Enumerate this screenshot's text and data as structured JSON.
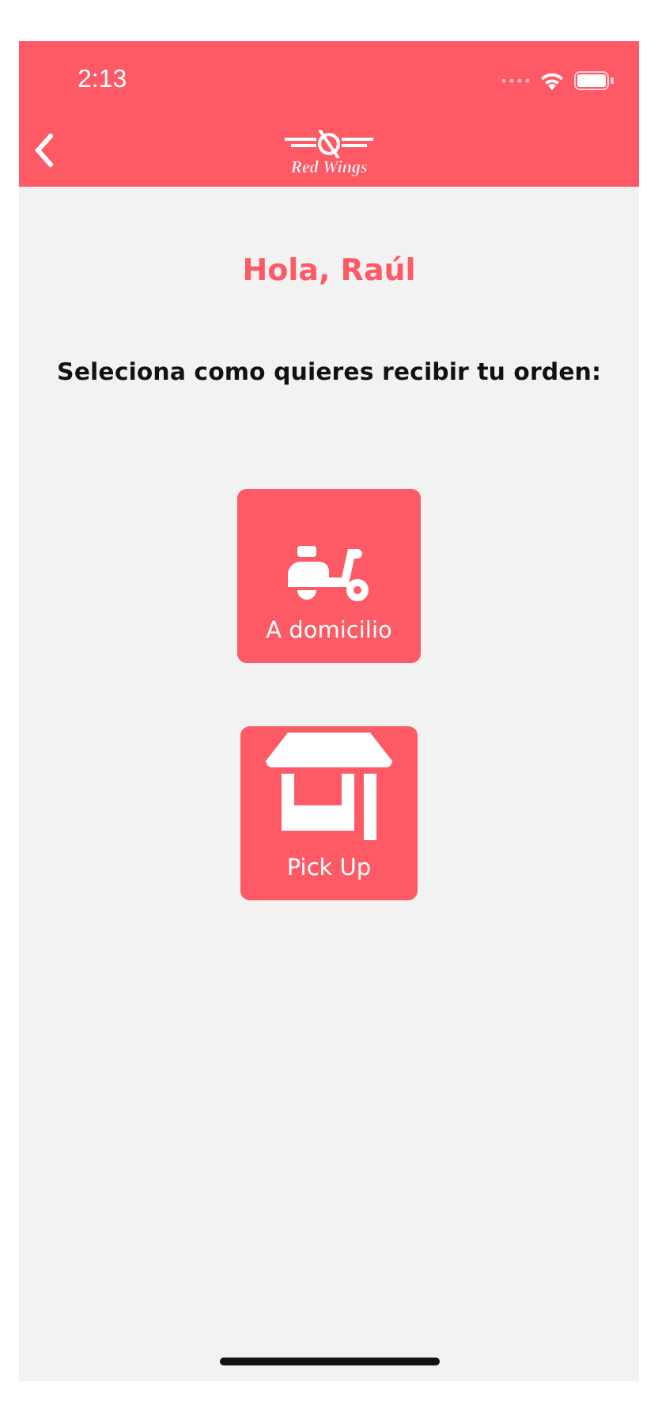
{
  "status_bar": {
    "time": "2:13"
  },
  "header": {
    "logo": "Red Wings"
  },
  "greeting": "Hola, Raúl",
  "prompt": "Seleciona como quieres recibir tu orden:",
  "options": [
    {
      "kind": "delivery",
      "label": "A domicilio"
    },
    {
      "kind": "pickup",
      "label": "Pick Up"
    }
  ]
}
